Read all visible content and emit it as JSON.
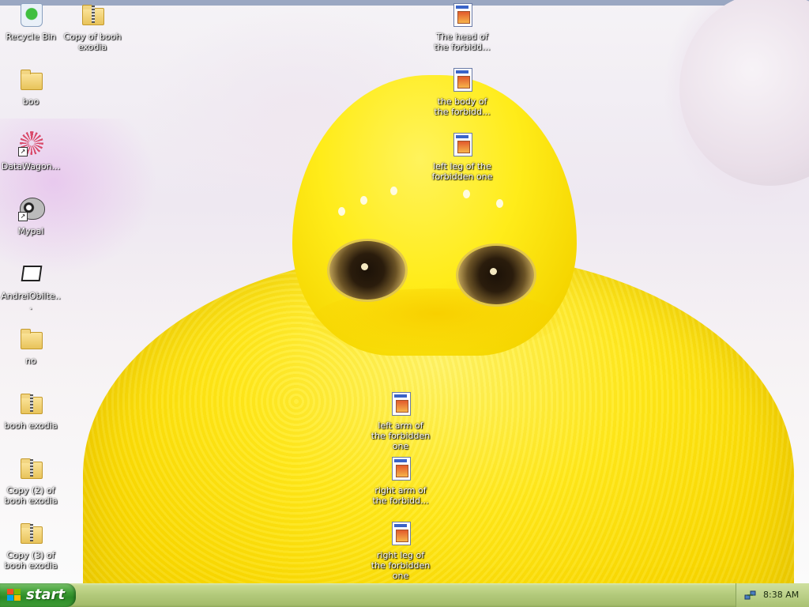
{
  "desktop": {
    "icons": [
      {
        "label": "Recycle Bin",
        "icon": "recycle-bin-icon"
      },
      {
        "label": "Copy of booh exodia",
        "icon": "zip-folder-icon"
      },
      {
        "label": "The head of the forbidd...",
        "icon": "image-document-icon"
      },
      {
        "label": "boo",
        "icon": "folder-icon"
      },
      {
        "label": "the body of the forbidd...",
        "icon": "image-document-icon"
      },
      {
        "label": "DataWagon...",
        "icon": "spirograph-shortcut-icon"
      },
      {
        "label": "left leg of the forbidden one",
        "icon": "image-document-icon"
      },
      {
        "label": "Mypal",
        "icon": "raccoon-shortcut-icon"
      },
      {
        "label": "AndreiObilte...",
        "icon": "window-shortcut-icon"
      },
      {
        "label": "no",
        "icon": "folder-icon"
      },
      {
        "label": "booh exodia",
        "icon": "zip-folder-icon"
      },
      {
        "label": "left arm of the forbidden one",
        "icon": "image-document-icon"
      },
      {
        "label": "right arm of the forbidd...",
        "icon": "image-document-icon"
      },
      {
        "label": "Copy (2) of booh exodia",
        "icon": "zip-folder-icon"
      },
      {
        "label": "right leg of the forbidden one",
        "icon": "image-document-icon"
      },
      {
        "label": "Copy (3) of booh exodia",
        "icon": "zip-folder-icon"
      }
    ]
  },
  "taskbar": {
    "start_label": "start",
    "clock": "8:38 AM",
    "tray_icon": "network-tray-icon"
  },
  "colors": {
    "taskbar": "#b2c97a",
    "start_button": "#3c9a33",
    "creature": "#ffe81a"
  }
}
